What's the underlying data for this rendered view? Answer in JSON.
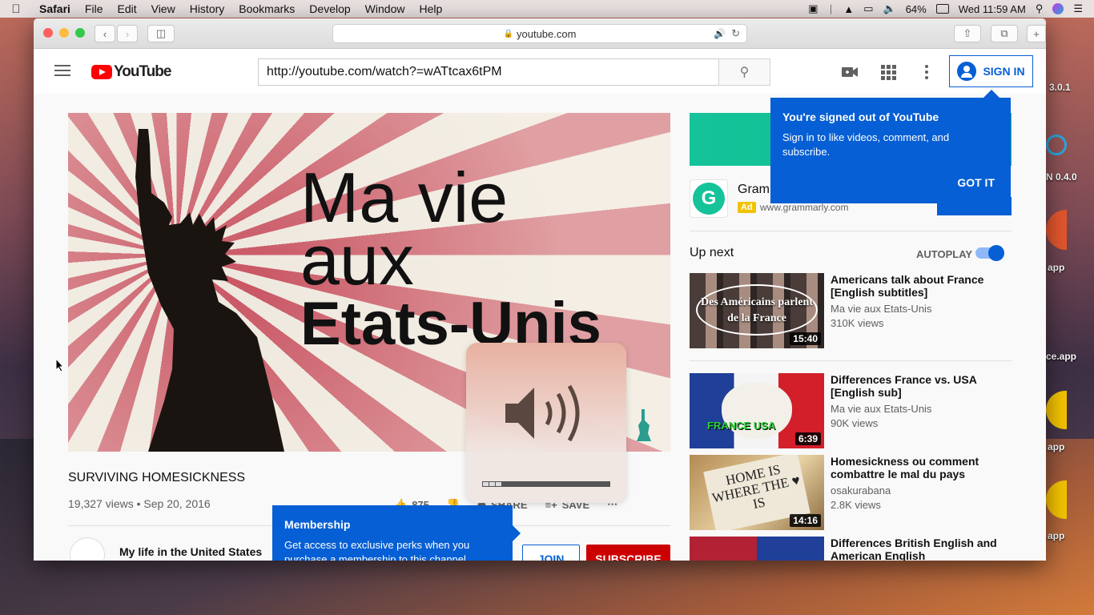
{
  "menubar": {
    "app": "Safari",
    "items": [
      "File",
      "Edit",
      "View",
      "History",
      "Bookmarks",
      "Develop",
      "Window",
      "Help"
    ],
    "battery": "64%",
    "clock": "Wed 11:59 AM"
  },
  "desktop": {
    "labels": [
      "3.0.1",
      "N 0.4.0",
      "app",
      "ce.app",
      "app",
      "app"
    ]
  },
  "browser": {
    "url_display": "youtube.com"
  },
  "youtube": {
    "logo_text": "YouTube",
    "search_value": "http://youtube.com/watch?=wATtcax6tPM",
    "sign_in": "SIGN IN",
    "video": {
      "overlay_line1": "Ma vie",
      "overlay_line2": "aux",
      "overlay_line3": "Etats-Unis",
      "title": "SURVIVING HOMESICKNESS",
      "meta": "19,327 views • Sep 20, 2016",
      "likes": "875",
      "share": "SHARE",
      "save": "SAVE"
    },
    "channel": {
      "name": "My life in the United States",
      "join": "JOIN",
      "subscribe": "SUBSCRIBE"
    },
    "membership_tip": {
      "title": "Membership",
      "body": "Get access to exclusive perks when you purchase a membership to this channel."
    },
    "ad": {
      "name": "Gramm",
      "badge": "Ad",
      "url": "www.grammarly.com",
      "logo_letter": "G"
    },
    "signin_tip": {
      "title": "You're signed out of YouTube",
      "body": "Sign in to like videos, comment, and subscribe.",
      "action": "GOT IT"
    },
    "up_next": "Up next",
    "autoplay": "AUTOPLAY",
    "autoplay_on": true,
    "volume_level": 0.2,
    "recommendations": [
      {
        "title": "Americans talk about France [English subtitles]",
        "channel": "Ma vie aux Etats-Unis",
        "views": "310K views",
        "duration": "15:40",
        "thumb_text": "Des Américains parlent de la France"
      },
      {
        "title": "Differences France vs. USA [English sub]",
        "channel": "Ma vie aux Etats-Unis",
        "views": "90K views",
        "duration": "6:39",
        "thumb_text": "FRANCE USA"
      },
      {
        "title": "Homesickness ou comment combattre le mal du pays",
        "channel": "osakurabana",
        "views": "2.8K views",
        "duration": "14:16",
        "thumb_text": "HOME IS WHERE THE ♥ IS"
      },
      {
        "title": "Differences British English and American English",
        "channel": "",
        "views": "",
        "duration": "",
        "thumb_text": ""
      }
    ]
  }
}
